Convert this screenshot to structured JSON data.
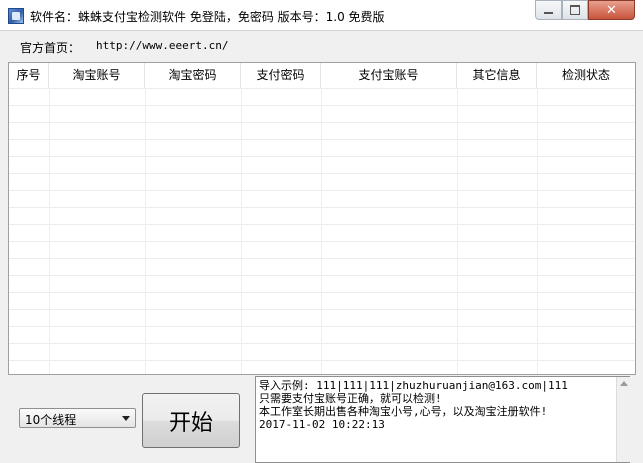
{
  "window": {
    "title": "软件名：蛛蛛支付宝检测软件 免登陆，免密码   版本号：1.0 免费版",
    "close_glyph": "✕"
  },
  "site": {
    "label": "官方首页：",
    "url": "http://www.eeert.cn/"
  },
  "grid": {
    "columns": [
      "序号",
      "淘宝账号",
      "淘宝密码",
      "支付密码",
      "支付宝账号",
      "其它信息",
      "检测状态"
    ],
    "rows": []
  },
  "controls": {
    "thread_select": "10个线程",
    "start_label": "开始"
  },
  "log": {
    "lines": [
      "导入示例: 111|111|111|zhuzhuruanjian@163.com|111",
      "只需要支付宝账号正确，就可以检测!",
      "本工作室长期出售各种淘宝小号,心号，以及淘宝注册软件!",
      " 2017-11-02 10:22:13"
    ]
  },
  "icons": {
    "app": "app-icon",
    "minimize": "minimize-icon",
    "maximize": "maximize-icon",
    "close": "close-icon",
    "dropdown": "chevron-down-icon"
  }
}
